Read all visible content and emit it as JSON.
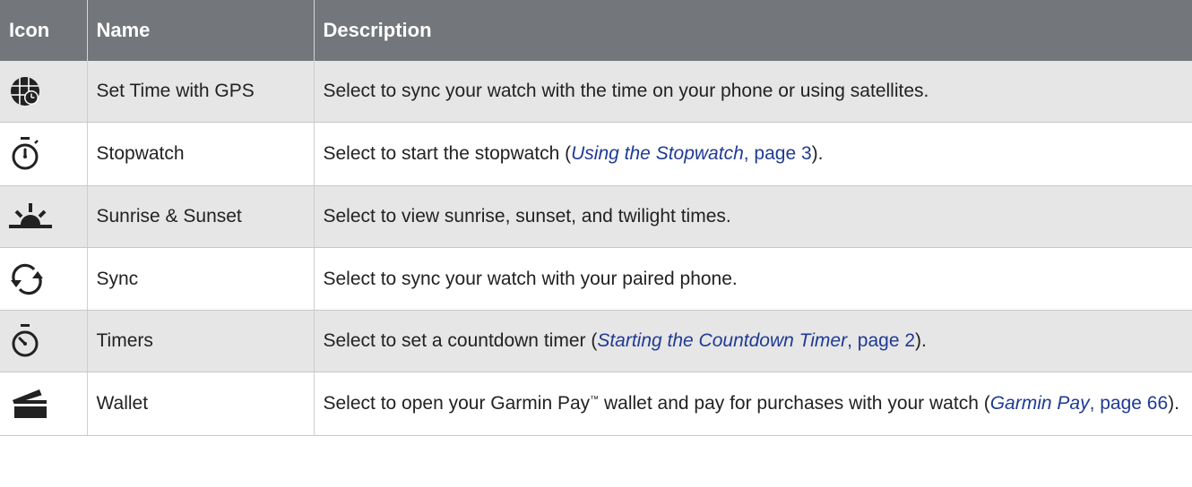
{
  "table": {
    "headers": {
      "icon": "Icon",
      "name": "Name",
      "description": "Description"
    },
    "rows": [
      {
        "icon": "globe-clock-icon",
        "name": "Set Time with GPS",
        "description": "Select to sync your watch with the time on your phone or using satellites."
      },
      {
        "icon": "stopwatch-icon",
        "name": "Stopwatch",
        "desc_before": "Select to start the stopwatch (",
        "link_title": "Using the Stopwatch",
        "link_page": ", page 3",
        "desc_after": ")."
      },
      {
        "icon": "sunrise-icon",
        "name": "Sunrise & Sunset",
        "description": "Select to view sunrise, sunset, and twilight times."
      },
      {
        "icon": "sync-arrows-icon",
        "name": "Sync",
        "description": "Select to sync your watch with your paired phone."
      },
      {
        "icon": "timer-icon",
        "name": "Timers",
        "desc_before": "Select to set a countdown timer (",
        "link_title": "Starting the Countdown Timer",
        "link_page": ", page 2",
        "desc_after": ")."
      },
      {
        "icon": "wallet-icon",
        "name": "Wallet",
        "desc_before": "Select to open your Garmin Pay",
        "tm": "™",
        "desc_mid": " wallet and pay for purchases with your watch (",
        "link_title": "Garmin Pay",
        "link_page": ", page 66",
        "desc_after": ")."
      }
    ]
  },
  "colors": {
    "header_bg": "#73767a",
    "header_text": "#ffffff",
    "shaded_row": "#e6e6e6",
    "link": "#1f3a93"
  }
}
